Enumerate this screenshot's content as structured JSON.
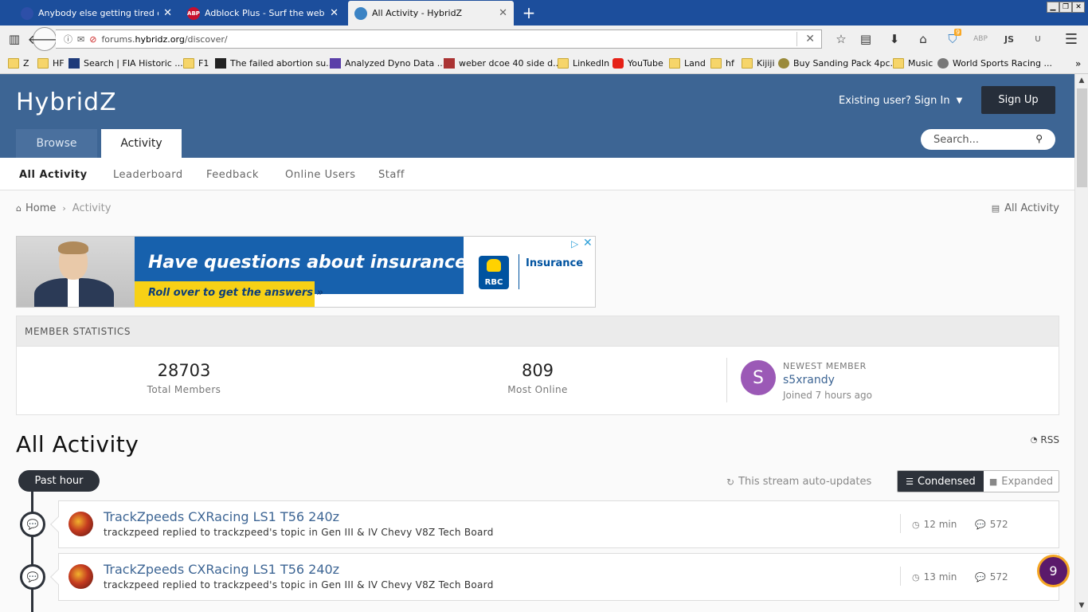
{
  "browser": {
    "tabs": [
      {
        "title": "Anybody else getting tired of th",
        "icon_color": "#2d4fa8"
      },
      {
        "title": "Adblock Plus - Surf the web with",
        "icon_color": "#c8102e",
        "icon_text": "ABP"
      },
      {
        "title": "All Activity - HybridZ",
        "icon_color": "#3b83c4"
      }
    ],
    "url_prefix": "forums.",
    "url_host": "hybridz.org",
    "url_path": "/discover/",
    "ext_badge": "9",
    "ext_abp": "ABP",
    "ext_js": "JS",
    "ext_u": "U",
    "bookmarks": [
      "Z",
      "HF",
      "Search | FIA Historic ...",
      "F1",
      "The failed abortion su...",
      "Analyzed Dyno Data ...",
      "weber dcoe 40 side d...",
      "LinkedIn",
      "YouTube",
      "Land",
      "hf",
      "Kijiji",
      "Buy Sanding Pack 4pc...",
      "Music",
      "World Sports Racing ..."
    ],
    "bookmark_more": "»"
  },
  "header": {
    "logo": "HybridZ",
    "signin": "Existing user? Sign In",
    "signup": "Sign Up",
    "tabs": [
      "Browse",
      "Activity"
    ],
    "search_placeholder": "Search..."
  },
  "subnav": [
    "All Activity",
    "Leaderboard",
    "Feedback",
    "Online Users",
    "Staff"
  ],
  "breadcrumb": {
    "home": "Home",
    "current": "Activity",
    "right": "All Activity"
  },
  "ad": {
    "headline": "Have questions about insurance?",
    "cta": "Roll over to get the answers »",
    "brand": "Insurance",
    "logo_text": "RBC"
  },
  "stats": {
    "heading": "MEMBER STATISTICS",
    "total_members": "28703",
    "total_members_label": "Total Members",
    "most_online": "809",
    "most_online_label": "Most Online",
    "newest_label": "NEWEST MEMBER",
    "newest_initial": "S",
    "newest_name": "s5xrandy",
    "newest_joined": "Joined 7 hours ago"
  },
  "activity": {
    "title": "All Activity",
    "rss": "RSS",
    "period": "Past hour",
    "autoupdate": "This stream auto-updates",
    "view_condensed": "Condensed",
    "view_expanded": "Expanded",
    "items": [
      {
        "title": "TrackZpeeds CXRacing LS1 T56 240z",
        "sub": "trackzpeed replied to trackzpeed's topic in Gen III & IV Chevy V8Z Tech Board",
        "time": "12 min",
        "replies": "572"
      },
      {
        "title": "TrackZpeeds CXRacing LS1 T56 240z",
        "sub": "trackzpeed replied to trackzpeed's topic in Gen III & IV Chevy V8Z Tech Board",
        "time": "13 min",
        "replies": "572"
      }
    ]
  },
  "notification_count": "9"
}
